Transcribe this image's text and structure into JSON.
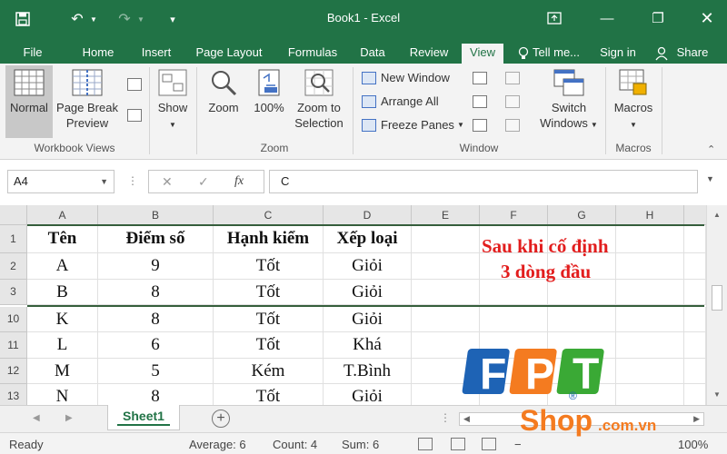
{
  "window": {
    "title": "Book1 - Excel"
  },
  "tabs": [
    "File",
    "Home",
    "Insert",
    "Page Layout",
    "Formulas",
    "Data",
    "Review",
    "View"
  ],
  "tell_me": "Tell me...",
  "sign_in": "Sign in",
  "share": "Share",
  "ribbon": {
    "normal": "Normal",
    "page_break_1": "Page Break",
    "page_break_2": "Preview",
    "workbook_views": "Workbook Views",
    "show": "Show",
    "zoom": "Zoom",
    "zoom_100": "100%",
    "zoom_to_1": "Zoom to",
    "zoom_to_2": "Selection",
    "zoom_group": "Zoom",
    "new_window": "New Window",
    "arrange_all": "Arrange All",
    "freeze_panes": "Freeze Panes",
    "switch_1": "Switch",
    "switch_2": "Windows",
    "window_group": "Window",
    "macros": "Macros",
    "macros_group": "Macros"
  },
  "formula_bar": {
    "name_box": "A4",
    "value": "C",
    "fx": "fx"
  },
  "columns": [
    "A",
    "B",
    "C",
    "D",
    "E",
    "F",
    "G",
    "H"
  ],
  "rows": [
    {
      "num": "1",
      "cells": [
        "Tên",
        "Điểm số",
        "Hạnh kiểm",
        "Xếp loại"
      ],
      "header": true
    },
    {
      "num": "2",
      "cells": [
        "A",
        "9",
        "Tốt",
        "Giỏi"
      ]
    },
    {
      "num": "3",
      "cells": [
        "B",
        "8",
        "Tốt",
        "Giỏi"
      ]
    },
    {
      "num": "10",
      "cells": [
        "K",
        "8",
        "Tốt",
        "Giỏi"
      ]
    },
    {
      "num": "11",
      "cells": [
        "L",
        "6",
        "Tốt",
        "Khá"
      ]
    },
    {
      "num": "12",
      "cells": [
        "M",
        "5",
        "Kém",
        "T.Bình"
      ]
    },
    {
      "num": "13",
      "cells": [
        "N",
        "8",
        "Tốt",
        "Giỏi"
      ]
    }
  ],
  "annotation": {
    "line1": "Sau khi cố định",
    "line2": "3 dòng đầu"
  },
  "sheet_tab": "Sheet1",
  "status": {
    "ready": "Ready",
    "average": "Average: 6",
    "count": "Count: 4",
    "sum": "Sum: 6",
    "zoom": "100%"
  },
  "logo": {
    "letters": [
      "F",
      "P",
      "T"
    ],
    "shop": "Shop",
    "domain": ".com.vn",
    "reg": "®"
  },
  "colors": {
    "excel_green": "#217346",
    "note_red": "#e21d1d",
    "fpt_blue": "#1e63b5",
    "fpt_orange": "#f47b20",
    "fpt_green": "#3aa935"
  }
}
